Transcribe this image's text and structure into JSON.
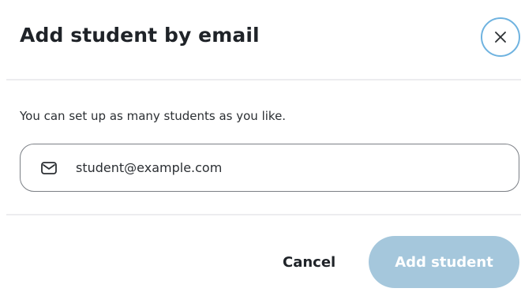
{
  "dialog": {
    "title": "Add student by email",
    "close_icon": "close-icon",
    "description": "You can set up as many students as you like.",
    "email_field": {
      "icon": "mail-icon",
      "value": "student@example.com"
    },
    "actions": {
      "cancel_label": "Cancel",
      "add_label": "Add student"
    }
  },
  "colors": {
    "accent_ring": "#6fb3e0",
    "primary_disabled": "#a5c7dc",
    "text": "#1f2328",
    "divider": "#ececef",
    "field_border": "#7b7f85"
  }
}
